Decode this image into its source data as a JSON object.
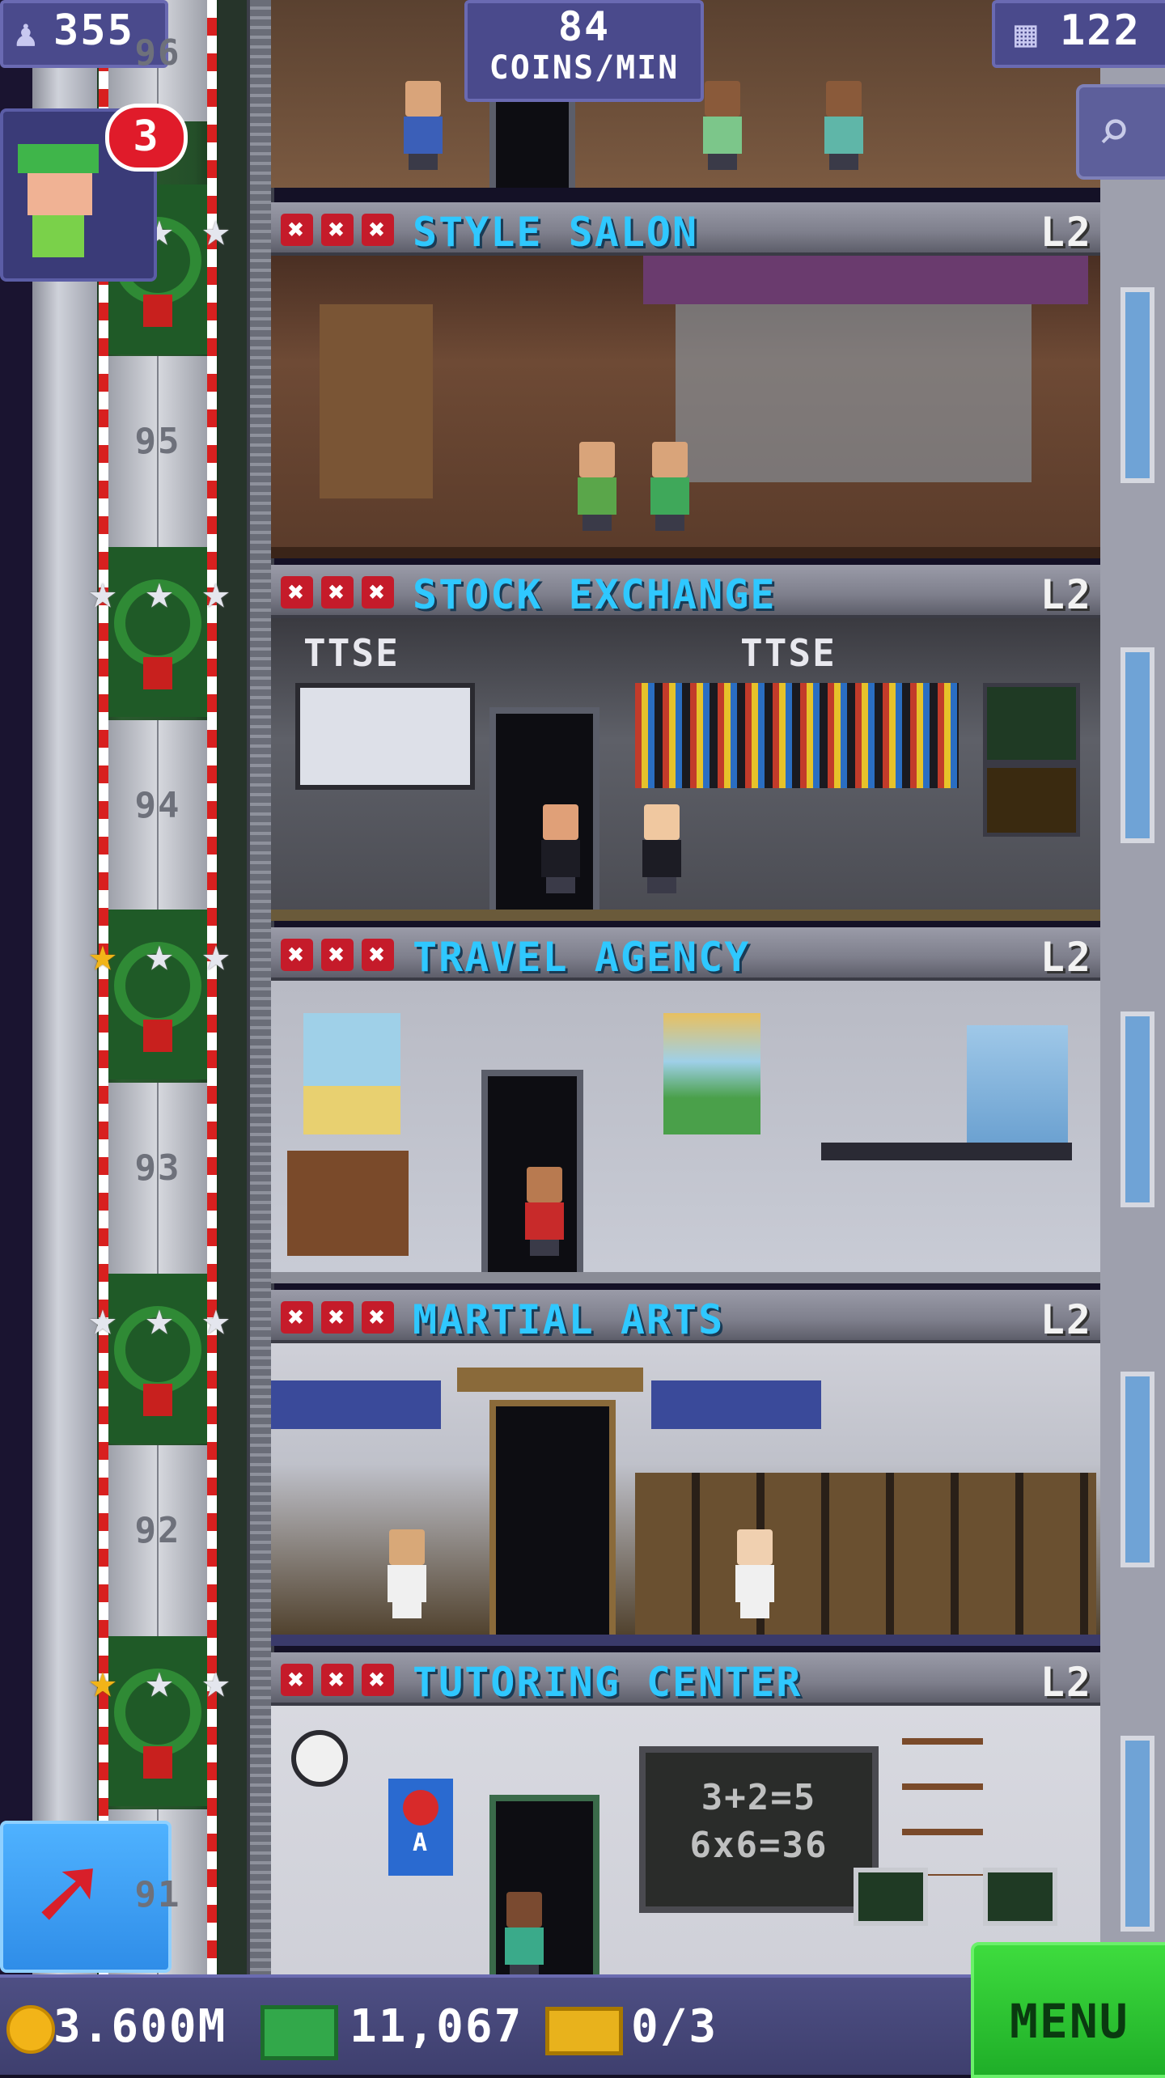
{
  "hud": {
    "population": "355",
    "coins_per_min_value": "84",
    "coins_per_min_label": "COINS/MIN",
    "floors": "122",
    "notification_count": "3"
  },
  "floors": [
    {
      "name": "STYLE SALON",
      "level": "L2",
      "x_marks": [
        "✖",
        "✖",
        "✖"
      ]
    },
    {
      "name": "STOCK EXCHANGE",
      "level": "L2",
      "x_marks": [
        "✖",
        "✖",
        "✖"
      ]
    },
    {
      "name": "TRAVEL AGENCY",
      "level": "L2",
      "x_marks": [
        "✖",
        "✖",
        "✖"
      ]
    },
    {
      "name": "MARTIAL ARTS",
      "level": "L2",
      "x_marks": [
        "✖",
        "✖",
        "✖"
      ]
    },
    {
      "name": "TUTORING CENTER",
      "level": "L2",
      "x_marks": [
        "✖",
        "✖",
        "✖"
      ]
    }
  ],
  "elevator": {
    "floor_numbers": [
      "96",
      "95",
      "94",
      "93",
      "92",
      "91"
    ],
    "stars": [
      [
        "silver",
        "silver",
        "silver"
      ],
      [
        "silver",
        "silver",
        "silver"
      ],
      [
        "gold",
        "silver",
        "silver"
      ],
      [
        "silver",
        "silver",
        "silver"
      ],
      [
        "gold",
        "silver",
        "silver"
      ]
    ]
  },
  "room_text": {
    "stock_sign_1": "TTSE",
    "stock_sign_2": "TTSE",
    "chalkboard_line_1": "3+2=5",
    "chalkboard_line_2": "6x6=36",
    "apple_poster": "A"
  },
  "bottom_bar": {
    "coins": "3.600M",
    "bux": "11,067",
    "tickets": "0/3",
    "menu_label": "MENU"
  },
  "colors": {
    "floor_name": "#2fc8ff",
    "x_mark": "#c51b2a",
    "menu_button": "#1fae28",
    "hud_box": "#4a4a8c"
  }
}
